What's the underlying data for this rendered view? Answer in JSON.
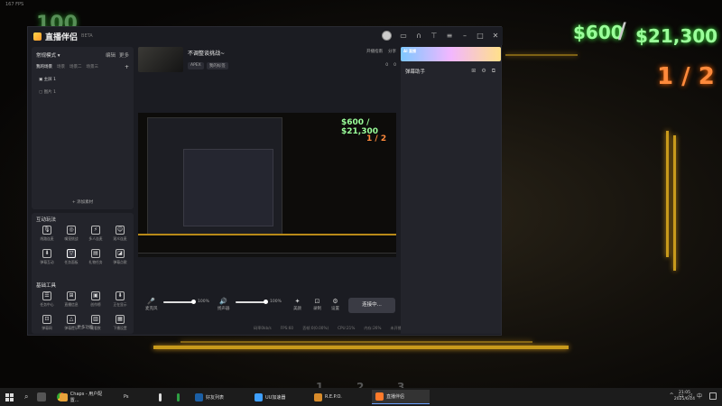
{
  "game": {
    "fps": "167 FPS",
    "money_current": "$600",
    "money_slash": "/",
    "money_target": "$21,300",
    "score": "1 / 2",
    "floor_numbers": [
      "1",
      "2",
      "3"
    ],
    "top_partial": "100"
  },
  "app": {
    "name": "直播伴侣",
    "version": "BETA",
    "titlebar_icons": [
      "avatar-icon",
      "message-icon",
      "headset-icon",
      "shirt-icon",
      "menu-icon",
      "minimize-icon",
      "maximize-icon",
      "close-icon"
    ],
    "left": {
      "mode_label": "常规模式 ▾",
      "mode_actions": [
        "编辑",
        "更多"
      ],
      "scene_tabs": [
        "我的场景",
        "场景",
        "场景二",
        "场景三"
      ],
      "scene_add": "+",
      "scenes": [
        {
          "label": "▣ 主屏 1"
        },
        {
          "label": "▢ 图片 1"
        }
      ],
      "add_material": "+ 添加素材",
      "interact_title": "互动玩法",
      "interact_tools": [
        {
          "label": "线路连麦",
          "icon": "🎙"
        },
        {
          "label": "嘴笼挑战",
          "icon": "◎"
        },
        {
          "label": "多人连麦",
          "icon": "⚡"
        },
        {
          "label": "观众连麦",
          "icon": "☺"
        },
        {
          "label": "弹幕互动",
          "icon": "⬇"
        },
        {
          "label": "任务面板",
          "icon": "▽"
        },
        {
          "label": "礼物任务",
          "icon": "▤"
        },
        {
          "label": "弹幕点歌",
          "icon": "◪"
        }
      ],
      "basic_title": "基础工具",
      "basic_tools": [
        {
          "label": "任务中心",
          "icon": "☰"
        },
        {
          "label": "直播信息",
          "icon": "⊞"
        },
        {
          "label": "创作榜",
          "icon": "▣"
        },
        {
          "label": "正在显示",
          "icon": "⬇"
        },
        {
          "label": "弹幕网",
          "icon": "⊡"
        },
        {
          "label": "弹幕提示",
          "icon": "△"
        },
        {
          "label": "观看数",
          "icon": "▥"
        },
        {
          "label": "下播设置",
          "icon": "▦"
        }
      ],
      "more_func": "··· 更多功能"
    },
    "stream": {
      "title": "不调整谈挑战~",
      "tags": [
        "APEX",
        "我的标签"
      ],
      "actions": [
        "开播指南",
        "分享"
      ],
      "stats": [
        "0",
        "0"
      ]
    },
    "preview": {
      "money": "$600 / $21,300",
      "score": "1 / 2"
    },
    "controls": {
      "mic_label": "麦克风",
      "mic_pct": "100%",
      "mic_level": 1.0,
      "speaker_label": "扬声器",
      "speaker_pct": "100%",
      "speaker_level": 1.0,
      "beauty_label": "美颜",
      "record_label": "录制",
      "settings_label": "设置",
      "live_button": "连接中..."
    },
    "status": [
      "码率0kb/s",
      "FPS:60",
      "丢帧:0(0.00%)",
      "CPU:21%",
      "内存:26%",
      "未开播"
    ],
    "right": {
      "banner_text": "AI 直播",
      "title": "弹幕助手",
      "icons": [
        "grid-icon",
        "gear-icon",
        "popout-icon"
      ]
    }
  },
  "taskbar": {
    "apps": [
      {
        "label": "Chaps - 用户配置...",
        "color": "#e8a33a"
      },
      {
        "label": "Ps",
        "color": "#2b78c8"
      },
      {
        "label": "",
        "color": "#ddd"
      },
      {
        "label": "",
        "color": "#2ea043"
      },
      {
        "label": "好友列表",
        "color": "#1b5fa5"
      },
      {
        "label": "UU加速器",
        "color": "#3fa0ff"
      },
      {
        "label": "R.E.P.O.",
        "color": "#d88b2a"
      },
      {
        "label": "直播伴侣",
        "color": "#ff7a2a"
      }
    ],
    "time": "21:05",
    "date": "2025/6/14"
  }
}
